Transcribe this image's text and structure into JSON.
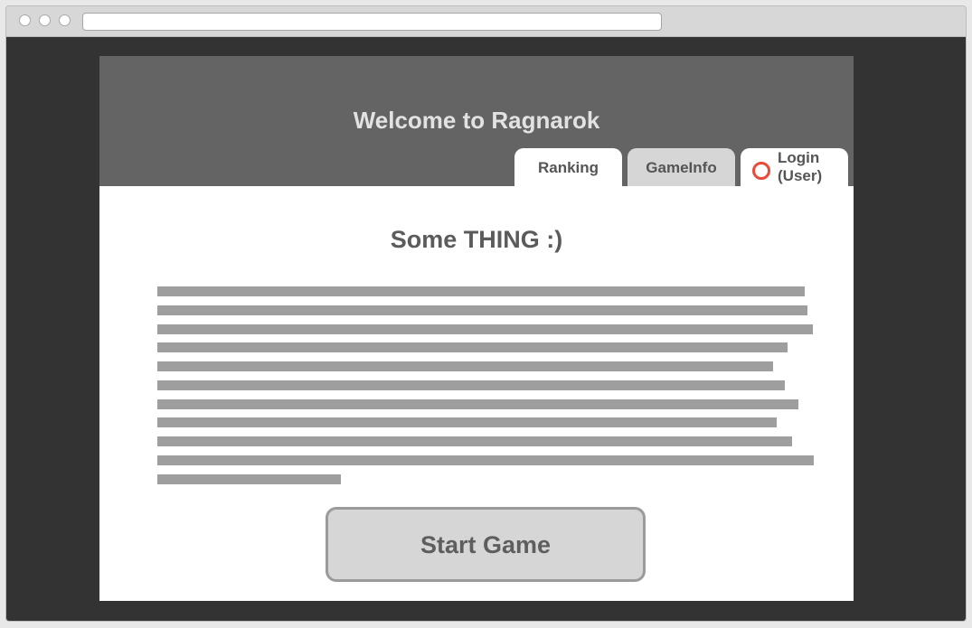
{
  "page": {
    "banner_title": "Welcome to Ragnarok",
    "heading": "Some THING :)",
    "start_button_label": "Start Game"
  },
  "tabs": {
    "ranking": "Ranking",
    "gameinfo": "GameInfo",
    "login": "Login\n(User)"
  },
  "colors": {
    "banner": "#646464",
    "viewport": "#333333",
    "login_indicator": "#e94a3a"
  }
}
